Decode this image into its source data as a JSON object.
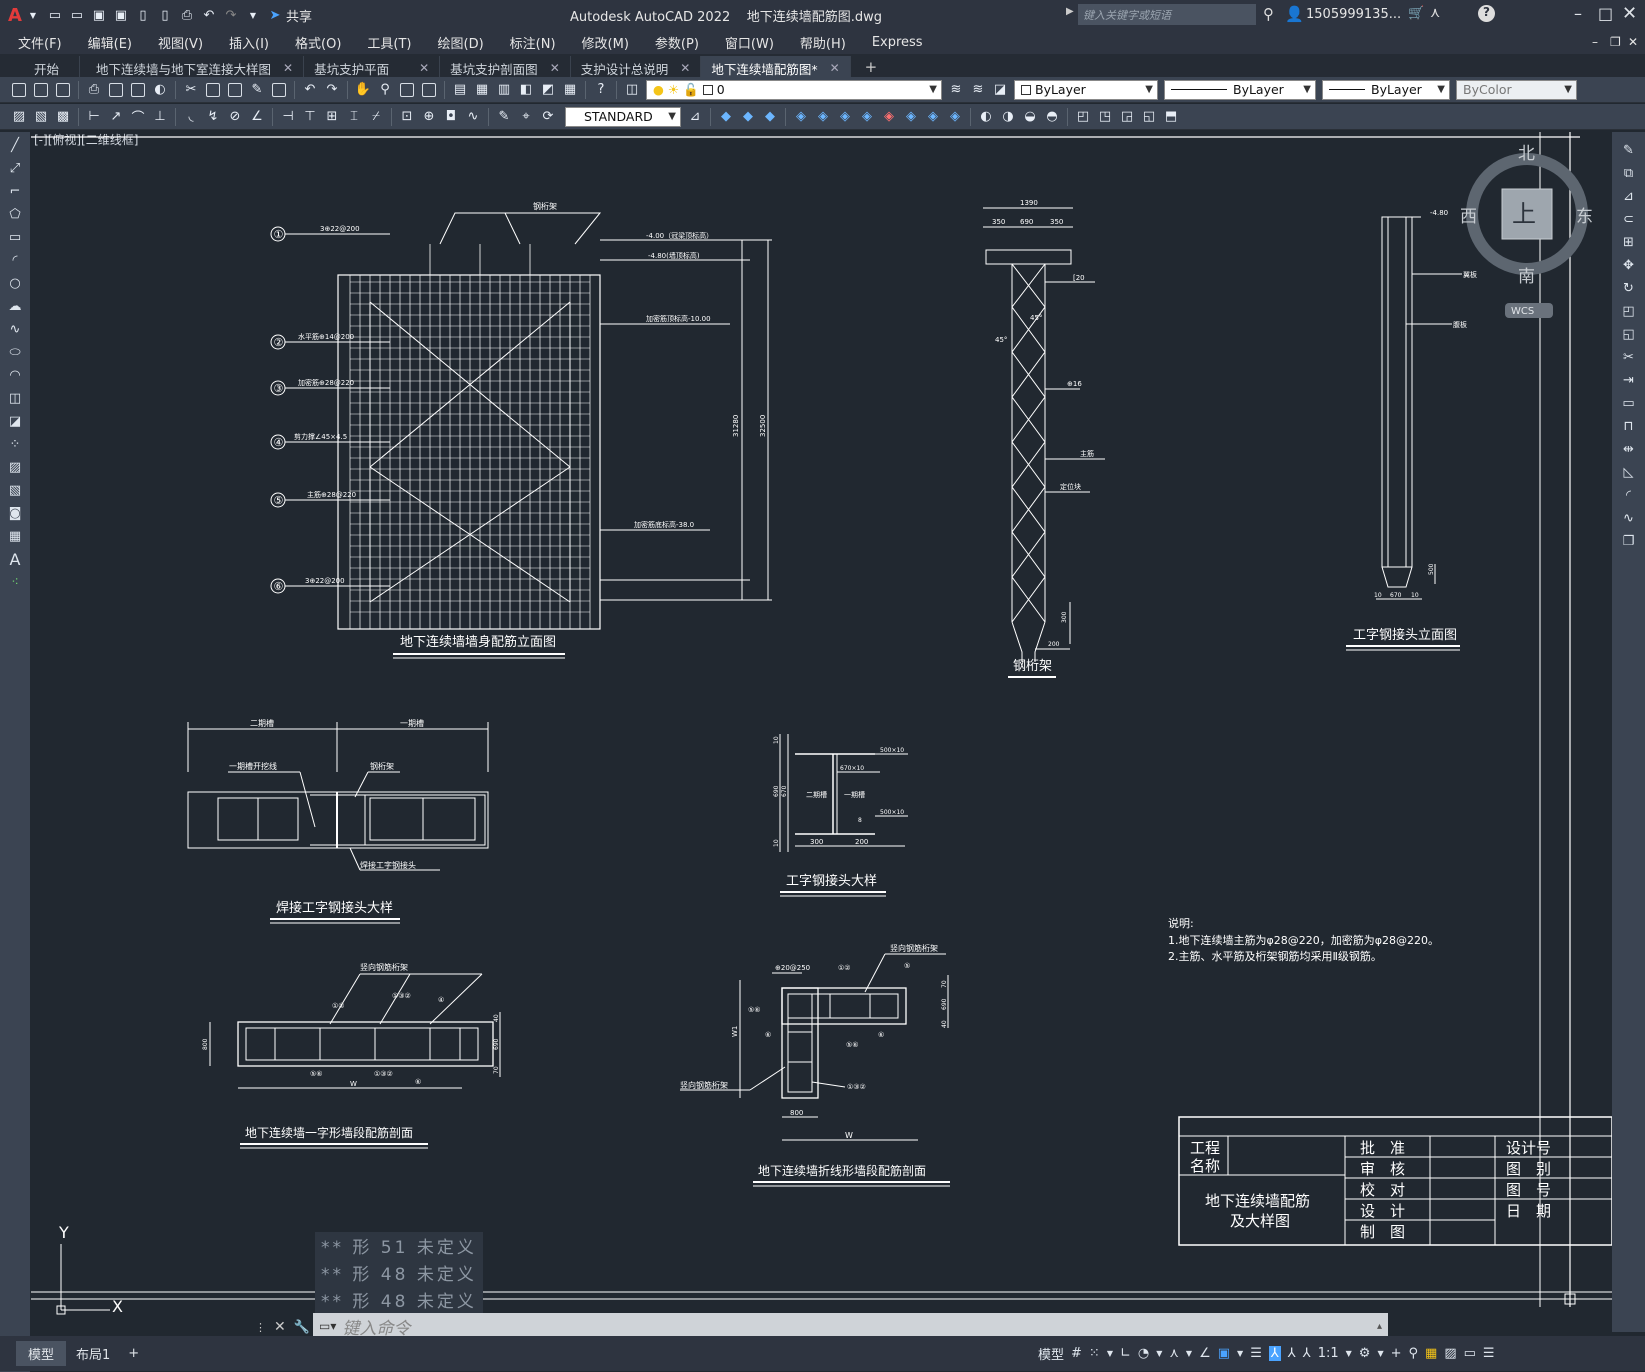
{
  "app": {
    "title": "Autodesk AutoCAD 2022",
    "filename": "地下连续墙配筋图.dwg",
    "share": "共享",
    "search_placeholder": "键入关键字或短语",
    "user": "1505999135...",
    "help": "?"
  },
  "menu": [
    "文件(F)",
    "编辑(E)",
    "视图(V)",
    "插入(I)",
    "格式(O)",
    "工具(T)",
    "绘图(D)",
    "标注(N)",
    "修改(M)",
    "参数(P)",
    "窗口(W)",
    "帮助(H)",
    "Express"
  ],
  "tabs": [
    {
      "label": "开始",
      "close": false
    },
    {
      "label": "地下连续墙与地下室连接大样图",
      "close": true
    },
    {
      "label": "基坑支护平面",
      "close": true
    },
    {
      "label": "基坑支护剖面图",
      "close": true
    },
    {
      "label": "支护设计总说明",
      "close": true
    },
    {
      "label": "地下连续墙配筋图*",
      "close": true,
      "active": true
    }
  ],
  "toolbar": {
    "layer": "0",
    "color": "ByLayer",
    "linetype": "ByLayer",
    "lineweight": "ByLayer",
    "plotstyle": "ByColor",
    "textstyle": "STANDARD"
  },
  "viewport": {
    "label": "[-][俯视][二维线框]"
  },
  "viewcube": {
    "n": "北",
    "s": "南",
    "e": "东",
    "w": "西",
    "top": "上",
    "wcs": "WCS"
  },
  "drawings": {
    "wall_elev": {
      "title": "地下连续墙墙身配筋立面图",
      "frame": "钢桁架",
      "c1": "①",
      "c2": "②",
      "c3": "③",
      "c4": "④",
      "c5": "⑤",
      "c6": "⑥",
      "l1": "3⊕22@200",
      "l2": "水平筋⊕14@200",
      "l3": "加密筋⊕28@220",
      "l4": "剪力撑∠45×4.5",
      "l5": "主筋⊕28@220",
      "l6": "3⊕22@200",
      "e1": "-4.00（冠梁顶标高）",
      "e2": "-4.80(墙顶标高)",
      "e3": "加密筋顶标高-10.00",
      "e4": "加密筋底标高-38.0",
      "d1": "31280",
      "d2": "32500"
    },
    "truss": {
      "title": "钢桁架",
      "w": "1390",
      "a": "350",
      "b": "690",
      "c": "350",
      "n1": "[20",
      "n2": "45°",
      "n3": "45°",
      "n4": "⊕16",
      "n5": "主筋",
      "n6": "定位块",
      "d1": "300",
      "d2": "200"
    },
    "ijoint_elev": {
      "title": "工字钢接头立面图",
      "el": "-4.80",
      "n1": "翼板",
      "n2": "腹板",
      "d1": "500",
      "d2": "10",
      "d3": "670",
      "d4": "10"
    },
    "weld_detail": {
      "title": "焊接工字钢接头大样",
      "s2": "二期槽",
      "s1": "一期槽",
      "a": "一期槽开挖线",
      "b": "钢桁架",
      "c": "焊接工字钢接头"
    },
    "ijoint_detail": {
      "title": "工字钢接头大样",
      "l1": "二期槽",
      "l2": "一期槽",
      "p1": "500×10",
      "p2": "670×10",
      "p3": "500×10",
      "d1": "10",
      "d2": "690",
      "d3": "670",
      "d4": "10",
      "d5": "300",
      "d6": "200",
      "d7": "8"
    },
    "straight_sec": {
      "title": "地下连续墙一字形墙段配筋剖面",
      "frame": "竖向钢筋桁架",
      "m1": "①②",
      "m2": "①③②",
      "m3": "④",
      "m4": "⑤⑥",
      "m5": "①③②",
      "m6": "⑥",
      "d1": "800",
      "d2": "40",
      "d3": "690",
      "d4": "70",
      "w": "W"
    },
    "corner_sec": {
      "title": "地下连续墙折线形墙段配筋剖面",
      "frame": "竖向钢筋桁架",
      "frame2": "竖向钢筋桁架",
      "p": "⊕20@250",
      "m1": "①②",
      "m2": "⑤",
      "m3": "⑤⑥",
      "m4": "⑥",
      "m5": "⑥",
      "m6": "⑤⑥",
      "m7": "①③②",
      "w1": "W1",
      "w": "W",
      "d1": "800",
      "d2": "70",
      "d3": "690",
      "d4": "40"
    },
    "notes": {
      "title": "说明:",
      "l1": "1.地下连续墙主筋为φ28@220，加密筋为φ28@220。",
      "l2": "2.主筋、水平筋及桁架钢筋均采用Ⅱ级钢筋。"
    },
    "titleblock": {
      "proj": "工程",
      "name": "名称",
      "drawing": "地下连续墙配筋",
      "drawing2": "及大样图",
      "r1": "批　准",
      "r2": "审　核",
      "r3": "校　对",
      "r4": "设　计",
      "r5": "制　图",
      "c1": "设计号",
      "c2": "图　别",
      "c3": "图　号",
      "c4": "日　期"
    }
  },
  "command": {
    "placeholder": "键入命令",
    "history": [
      "** 形 51 未定义",
      "** 形 48 未定义",
      "** 形 48 未定义"
    ]
  },
  "layout_tabs": [
    "模型",
    "布局1",
    "+"
  ],
  "status": {
    "model": "模型",
    "scale": "1:1"
  },
  "ucs": {
    "x": "X",
    "y": "Y"
  }
}
